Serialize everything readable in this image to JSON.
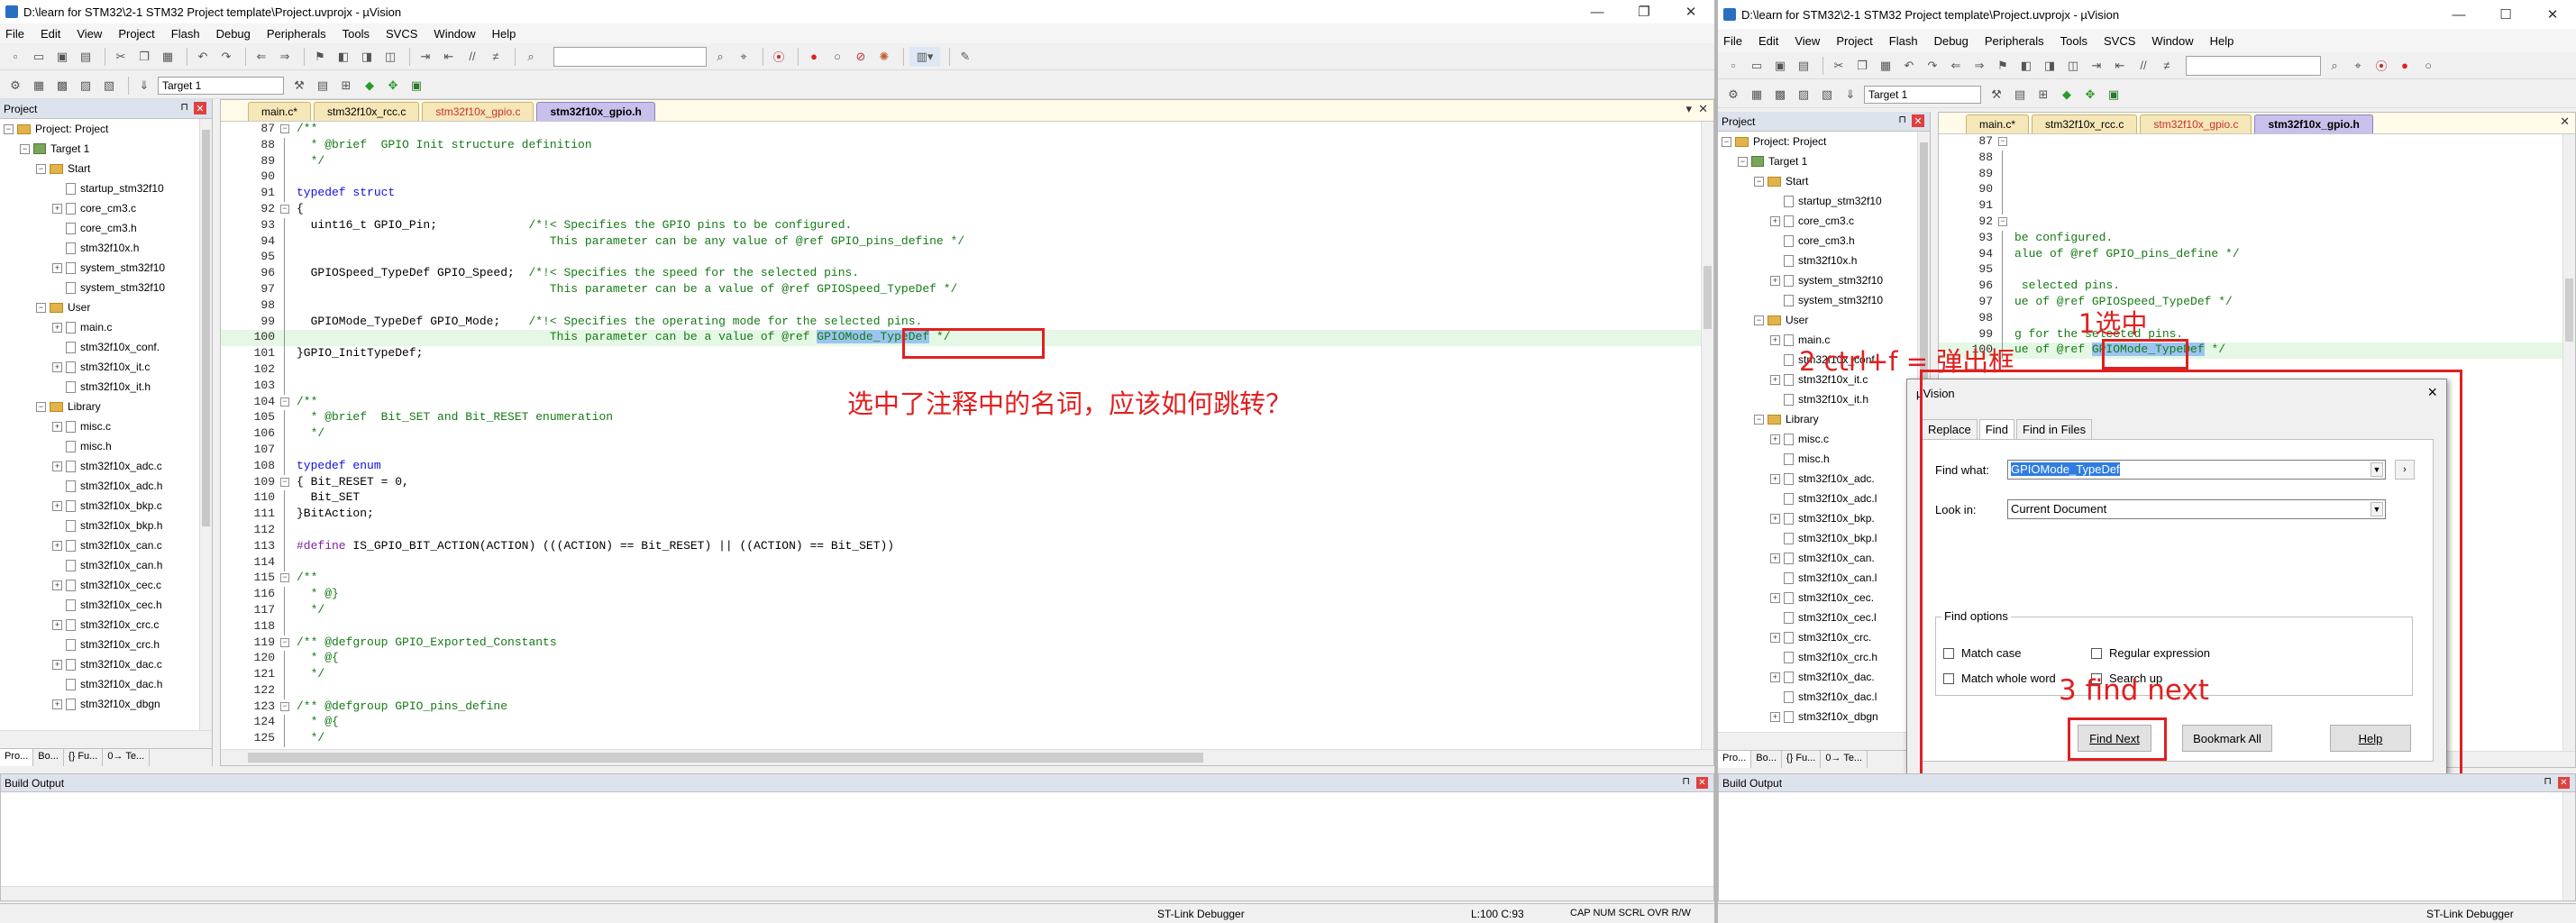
{
  "left": {
    "title": "D:\\learn for STM32\\2-1 STM32 Project template\\Project.uvprojx - µVision",
    "menu": [
      "File",
      "Edit",
      "View",
      "Project",
      "Flash",
      "Debug",
      "Peripherals",
      "Tools",
      "SVCS",
      "Window",
      "Help"
    ],
    "target": "Target 1",
    "project_header": "Project",
    "tree": [
      {
        "label": "Project: Project",
        "indent": 0,
        "kind": "minus-root"
      },
      {
        "label": "Target 1",
        "indent": 1,
        "kind": "target"
      },
      {
        "label": "Start",
        "indent": 2,
        "kind": "folder"
      },
      {
        "label": "startup_stm32f10",
        "indent": 3,
        "kind": "file"
      },
      {
        "label": "core_cm3.c",
        "indent": 3,
        "kind": "plusfile"
      },
      {
        "label": "core_cm3.h",
        "indent": 3,
        "kind": "file"
      },
      {
        "label": "stm32f10x.h",
        "indent": 3,
        "kind": "file"
      },
      {
        "label": "system_stm32f10",
        "indent": 3,
        "kind": "plusfile"
      },
      {
        "label": "system_stm32f10",
        "indent": 3,
        "kind": "file"
      },
      {
        "label": "User",
        "indent": 2,
        "kind": "folder"
      },
      {
        "label": "main.c",
        "indent": 3,
        "kind": "plusfile"
      },
      {
        "label": "stm32f10x_conf.",
        "indent": 3,
        "kind": "file"
      },
      {
        "label": "stm32f10x_it.c",
        "indent": 3,
        "kind": "plusfile"
      },
      {
        "label": "stm32f10x_it.h",
        "indent": 3,
        "kind": "file"
      },
      {
        "label": "Library",
        "indent": 2,
        "kind": "folder"
      },
      {
        "label": "misc.c",
        "indent": 3,
        "kind": "plusfile"
      },
      {
        "label": "misc.h",
        "indent": 3,
        "kind": "file"
      },
      {
        "label": "stm32f10x_adc.c",
        "indent": 3,
        "kind": "plusfile"
      },
      {
        "label": "stm32f10x_adc.h",
        "indent": 3,
        "kind": "file"
      },
      {
        "label": "stm32f10x_bkp.c",
        "indent": 3,
        "kind": "plusfile"
      },
      {
        "label": "stm32f10x_bkp.h",
        "indent": 3,
        "kind": "file"
      },
      {
        "label": "stm32f10x_can.c",
        "indent": 3,
        "kind": "plusfile"
      },
      {
        "label": "stm32f10x_can.h",
        "indent": 3,
        "kind": "file"
      },
      {
        "label": "stm32f10x_cec.c",
        "indent": 3,
        "kind": "plusfile"
      },
      {
        "label": "stm32f10x_cec.h",
        "indent": 3,
        "kind": "file"
      },
      {
        "label": "stm32f10x_crc.c",
        "indent": 3,
        "kind": "plusfile"
      },
      {
        "label": "stm32f10x_crc.h",
        "indent": 3,
        "kind": "file"
      },
      {
        "label": "stm32f10x_dac.c",
        "indent": 3,
        "kind": "plusfile"
      },
      {
        "label": "stm32f10x_dac.h",
        "indent": 3,
        "kind": "file"
      },
      {
        "label": "stm32f10x_dbgn",
        "indent": 3,
        "kind": "plusfile"
      }
    ],
    "panel_tabs": [
      "Pro...",
      "Bo...",
      "{} Fu...",
      "0→ Te..."
    ],
    "editor_tabs": [
      {
        "label": "main.c*",
        "state": "plain"
      },
      {
        "label": "stm32f10x_rcc.c",
        "state": "plain"
      },
      {
        "label": "stm32f10x_gpio.c",
        "state": "red"
      },
      {
        "label": "stm32f10x_gpio.h",
        "state": "active"
      }
    ],
    "code": [
      {
        "n": "87",
        "fold": "-",
        "t": [
          {
            "c": "cm",
            "s": "/**"
          }
        ]
      },
      {
        "n": "88",
        "t": [
          {
            "c": "cm",
            "s": "  * @brief  GPIO Init structure definition"
          }
        ]
      },
      {
        "n": "89",
        "t": [
          {
            "c": "cm",
            "s": "  */"
          }
        ]
      },
      {
        "n": "90",
        "t": []
      },
      {
        "n": "91",
        "t": [
          {
            "c": "kw",
            "s": "typedef struct"
          }
        ]
      },
      {
        "n": "92",
        "fold": "-",
        "t": [
          {
            "s": "{"
          }
        ]
      },
      {
        "n": "93",
        "t": [
          {
            "s": "  uint16_t GPIO_Pin;             "
          },
          {
            "c": "cm",
            "s": "/*!< Specifies the GPIO pins to be configured."
          }
        ]
      },
      {
        "n": "94",
        "t": [
          {
            "c": "cm",
            "s": "                                    This parameter can be any value of @ref GPIO_pins_define */"
          }
        ]
      },
      {
        "n": "95",
        "t": []
      },
      {
        "n": "96",
        "t": [
          {
            "s": "  GPIOSpeed_TypeDef GPIO_Speed;  "
          },
          {
            "c": "cm",
            "s": "/*!< Specifies the speed for the selected pins."
          }
        ]
      },
      {
        "n": "97",
        "t": [
          {
            "c": "cm",
            "s": "                                    This parameter can be a value of @ref GPIOSpeed_TypeDef */"
          }
        ]
      },
      {
        "n": "98",
        "t": []
      },
      {
        "n": "99",
        "t": [
          {
            "s": "  GPIOMode_TypeDef GPIO_Mode;    "
          },
          {
            "c": "cm",
            "s": "/*!< Specifies the operating mode for the selected pins."
          }
        ]
      },
      {
        "n": "100",
        "hl": true,
        "t": [
          {
            "c": "cm",
            "s": "                                    This parameter can be a value of @ref "
          },
          {
            "c": "cm sel",
            "s": "GPIOMode_TypeDef"
          },
          {
            "c": "cm",
            "s": " */"
          }
        ]
      },
      {
        "n": "101",
        "t": [
          {
            "s": "}GPIO_InitTypeDef;"
          }
        ]
      },
      {
        "n": "102",
        "t": []
      },
      {
        "n": "103",
        "t": []
      },
      {
        "n": "104",
        "fold": "-",
        "t": [
          {
            "c": "cm",
            "s": "/**"
          }
        ]
      },
      {
        "n": "105",
        "t": [
          {
            "c": "cm",
            "s": "  * @brief  Bit_SET and Bit_RESET enumeration"
          }
        ]
      },
      {
        "n": "106",
        "t": [
          {
            "c": "cm",
            "s": "  */"
          }
        ]
      },
      {
        "n": "107",
        "t": []
      },
      {
        "n": "108",
        "t": [
          {
            "c": "kw",
            "s": "typedef enum"
          }
        ]
      },
      {
        "n": "109",
        "fold": "-",
        "t": [
          {
            "s": "{ Bit_RESET = 0,"
          }
        ]
      },
      {
        "n": "110",
        "t": [
          {
            "s": "  Bit_SET"
          }
        ]
      },
      {
        "n": "111",
        "t": [
          {
            "s": "}BitAction;"
          }
        ]
      },
      {
        "n": "112",
        "t": []
      },
      {
        "n": "113",
        "t": [
          {
            "c": "pp",
            "s": "#define"
          },
          {
            "s": " IS_GPIO_BIT_ACTION(ACTION) (((ACTION) == Bit_RESET) || ((ACTION) == Bit_SET))"
          }
        ]
      },
      {
        "n": "114",
        "t": []
      },
      {
        "n": "115",
        "fold": "-",
        "t": [
          {
            "c": "cm",
            "s": "/**"
          }
        ]
      },
      {
        "n": "116",
        "t": [
          {
            "c": "cm",
            "s": "  * @}"
          }
        ]
      },
      {
        "n": "117",
        "t": [
          {
            "c": "cm",
            "s": "  */"
          }
        ]
      },
      {
        "n": "118",
        "t": []
      },
      {
        "n": "119",
        "fold": "-",
        "t": [
          {
            "c": "cm",
            "s": "/** @defgroup GPIO_Exported_Constants"
          }
        ]
      },
      {
        "n": "120",
        "t": [
          {
            "c": "cm",
            "s": "  * @{"
          }
        ]
      },
      {
        "n": "121",
        "t": [
          {
            "c": "cm",
            "s": "  */"
          }
        ]
      },
      {
        "n": "122",
        "t": []
      },
      {
        "n": "123",
        "fold": "-",
        "t": [
          {
            "c": "cm",
            "s": "/** @defgroup GPIO_pins_define"
          }
        ]
      },
      {
        "n": "124",
        "t": [
          {
            "c": "cm",
            "s": "  * @{"
          }
        ]
      },
      {
        "n": "125",
        "t": [
          {
            "c": "cm",
            "s": "  */"
          }
        ]
      }
    ],
    "annotation": "选中了注释中的名词，应该如何跳转？",
    "build_output": "Build Output",
    "status_debugger": "ST-Link Debugger",
    "status_pos": "L:100 C:93",
    "status_flags": "CAP  NUM  SCRL  OVR  R/W"
  },
  "right": {
    "title": "D:\\learn for STM32\\2-1 STM32 Project template\\Project.uvprojx - µVision",
    "menu": [
      "File",
      "Edit",
      "View",
      "Project",
      "Flash",
      "Debug",
      "Peripherals",
      "Tools",
      "SVCS",
      "Window",
      "Help"
    ],
    "target": "Target 1",
    "project_header": "Project",
    "tree": [
      {
        "label": "Project: Project",
        "indent": 0,
        "kind": "minus-root"
      },
      {
        "label": "Target 1",
        "indent": 1,
        "kind": "target"
      },
      {
        "label": "Start",
        "indent": 2,
        "kind": "folder"
      },
      {
        "label": "startup_stm32f10",
        "indent": 3,
        "kind": "file"
      },
      {
        "label": "core_cm3.c",
        "indent": 3,
        "kind": "plusfile"
      },
      {
        "label": "core_cm3.h",
        "indent": 3,
        "kind": "file"
      },
      {
        "label": "stm32f10x.h",
        "indent": 3,
        "kind": "file"
      },
      {
        "label": "system_stm32f10",
        "indent": 3,
        "kind": "plusfile"
      },
      {
        "label": "system_stm32f10",
        "indent": 3,
        "kind": "file"
      },
      {
        "label": "User",
        "indent": 2,
        "kind": "folder"
      },
      {
        "label": "main.c",
        "indent": 3,
        "kind": "plusfile"
      },
      {
        "label": "stm32f10x_conf.",
        "indent": 3,
        "kind": "file"
      },
      {
        "label": "stm32f10x_it.c",
        "indent": 3,
        "kind": "plusfile"
      },
      {
        "label": "stm32f10x_it.h",
        "indent": 3,
        "kind": "file"
      },
      {
        "label": "Library",
        "indent": 2,
        "kind": "folder"
      },
      {
        "label": "misc.c",
        "indent": 3,
        "kind": "plusfile"
      },
      {
        "label": "misc.h",
        "indent": 3,
        "kind": "file"
      },
      {
        "label": "stm32f10x_adc.",
        "indent": 3,
        "kind": "plusfile"
      },
      {
        "label": "stm32f10x_adc.l",
        "indent": 3,
        "kind": "file"
      },
      {
        "label": "stm32f10x_bkp.",
        "indent": 3,
        "kind": "plusfile"
      },
      {
        "label": "stm32f10x_bkp.l",
        "indent": 3,
        "kind": "file"
      },
      {
        "label": "stm32f10x_can.",
        "indent": 3,
        "kind": "plusfile"
      },
      {
        "label": "stm32f10x_can.l",
        "indent": 3,
        "kind": "file"
      },
      {
        "label": "stm32f10x_cec.",
        "indent": 3,
        "kind": "plusfile"
      },
      {
        "label": "stm32f10x_cec.l",
        "indent": 3,
        "kind": "file"
      },
      {
        "label": "stm32f10x_crc.",
        "indent": 3,
        "kind": "plusfile"
      },
      {
        "label": "stm32f10x_crc.h",
        "indent": 3,
        "kind": "file"
      },
      {
        "label": "stm32f10x_dac.",
        "indent": 3,
        "kind": "plusfile"
      },
      {
        "label": "stm32f10x_dac.l",
        "indent": 3,
        "kind": "file"
      },
      {
        "label": "stm32f10x_dbgn",
        "indent": 3,
        "kind": "plusfile"
      }
    ],
    "panel_tabs": [
      "Pro...",
      "Bo...",
      "{} Fu...",
      "0→ Te..."
    ],
    "editor_tabs": [
      {
        "label": "main.c*",
        "state": "plain"
      },
      {
        "label": "stm32f10x_rcc.c",
        "state": "plain"
      },
      {
        "label": "stm32f10x_gpio.c",
        "state": "red"
      },
      {
        "label": "stm32f10x_gpio.h",
        "state": "active"
      }
    ],
    "code": [
      {
        "n": "87",
        "fold": "-",
        "t": []
      },
      {
        "n": "88",
        "t": []
      },
      {
        "n": "89",
        "t": []
      },
      {
        "n": "90",
        "t": []
      },
      {
        "n": "91",
        "t": []
      },
      {
        "n": "92",
        "fold": "-",
        "t": []
      },
      {
        "n": "93",
        "t": [
          {
            "c": "cm",
            "s": "be configured."
          }
        ]
      },
      {
        "n": "94",
        "t": [
          {
            "c": "cm",
            "s": "alue of @ref GPIO_pins_define */"
          }
        ]
      },
      {
        "n": "95",
        "t": []
      },
      {
        "n": "96",
        "t": [
          {
            "c": "cm",
            "s": " selected pins."
          }
        ]
      },
      {
        "n": "97",
        "t": [
          {
            "c": "cm",
            "s": "ue of @ref GPIOSpeed_TypeDef */"
          }
        ]
      },
      {
        "n": "98",
        "t": []
      },
      {
        "n": "99",
        "t": [
          {
            "c": "cm",
            "s": "g for the selected pins."
          }
        ]
      },
      {
        "n": "100",
        "hl": true,
        "t": [
          {
            "c": "cm",
            "s": "ue of @ref "
          },
          {
            "c": "cm sel",
            "s": "GPIOMode_TypeDef"
          },
          {
            "c": "cm",
            "s": " */"
          }
        ]
      }
    ],
    "dialog": {
      "title": "µVision",
      "tabs": [
        "Replace",
        "Find",
        "Find in Files"
      ],
      "active_tab": "Find",
      "find_label": "Find what:",
      "find_value": "GPIOMode_TypeDef",
      "look_label": "Look in:",
      "look_value": "Current Document",
      "options_label": "Find options",
      "match_case": "Match case",
      "match_whole": "Match whole word",
      "regex": "Regular expression",
      "search_up": "Search up",
      "find_next": "Find Next",
      "bookmark_all": "Bookmark All",
      "help": "Help",
      "close": "×"
    },
    "annotations": {
      "step1": "1选中",
      "step2": "2 ctrl+f = 弹出框",
      "step3": "3 find next"
    },
    "build_output": "Build Output",
    "status_debugger": "ST-Link Debugger"
  }
}
